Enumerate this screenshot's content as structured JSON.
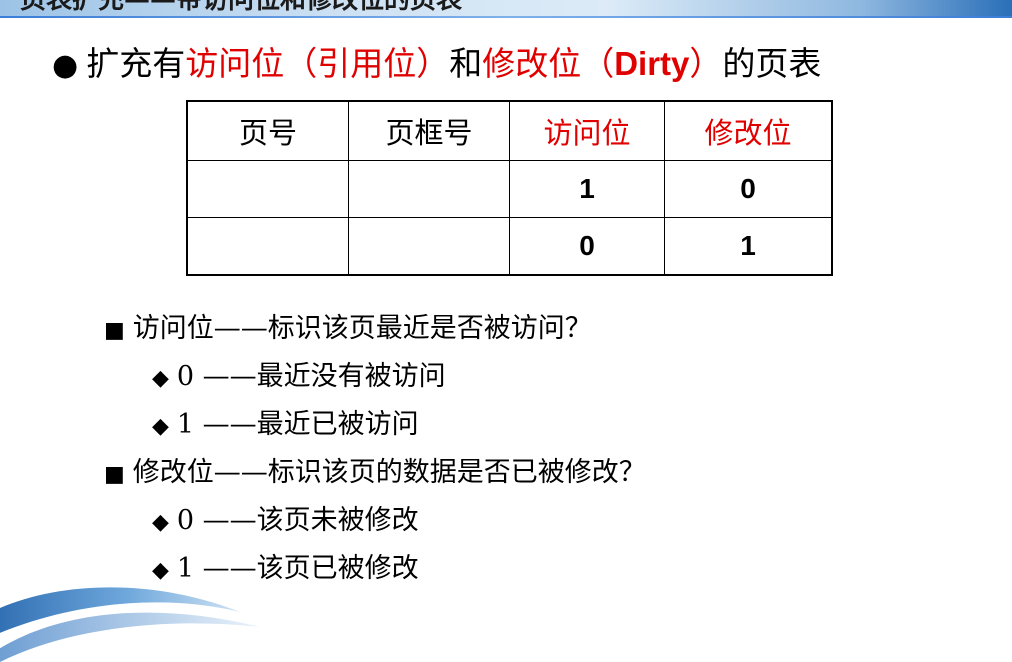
{
  "header": {
    "title": "页表扩充——带访问位和修改位的页表"
  },
  "heading": {
    "bullet": "●",
    "part1": "扩充有",
    "part2": "访问位（引用位）",
    "part3": "和",
    "part4": "修改位（",
    "part5": "Dirty",
    "part6": "）",
    "part7": "的页表"
  },
  "table": {
    "headers": [
      "页号",
      "页框号",
      "访问位",
      "修改位"
    ],
    "rows": [
      [
        "",
        "",
        "1",
        "0"
      ],
      [
        "",
        "",
        "0",
        "1"
      ]
    ]
  },
  "notes": [
    {
      "level": 1,
      "mark": "■",
      "text": "访问位——标识该页最近是否被访问？"
    },
    {
      "level": 2,
      "mark": "◆",
      "text": "0 ——最近没有被访问"
    },
    {
      "level": 2,
      "mark": "◆",
      "text": "1 ——最近已被访问"
    },
    {
      "level": 1,
      "mark": "■",
      "text": "修改位——标识该页的数据是否已被修改？"
    },
    {
      "level": 2,
      "mark": "◆",
      "text": "0 ——该页未被修改"
    },
    {
      "level": 2,
      "mark": "◆",
      "text": "1 ——该页已被修改"
    }
  ],
  "colors": {
    "accent": "#e00000",
    "band_blue": "#2a6fb8"
  }
}
